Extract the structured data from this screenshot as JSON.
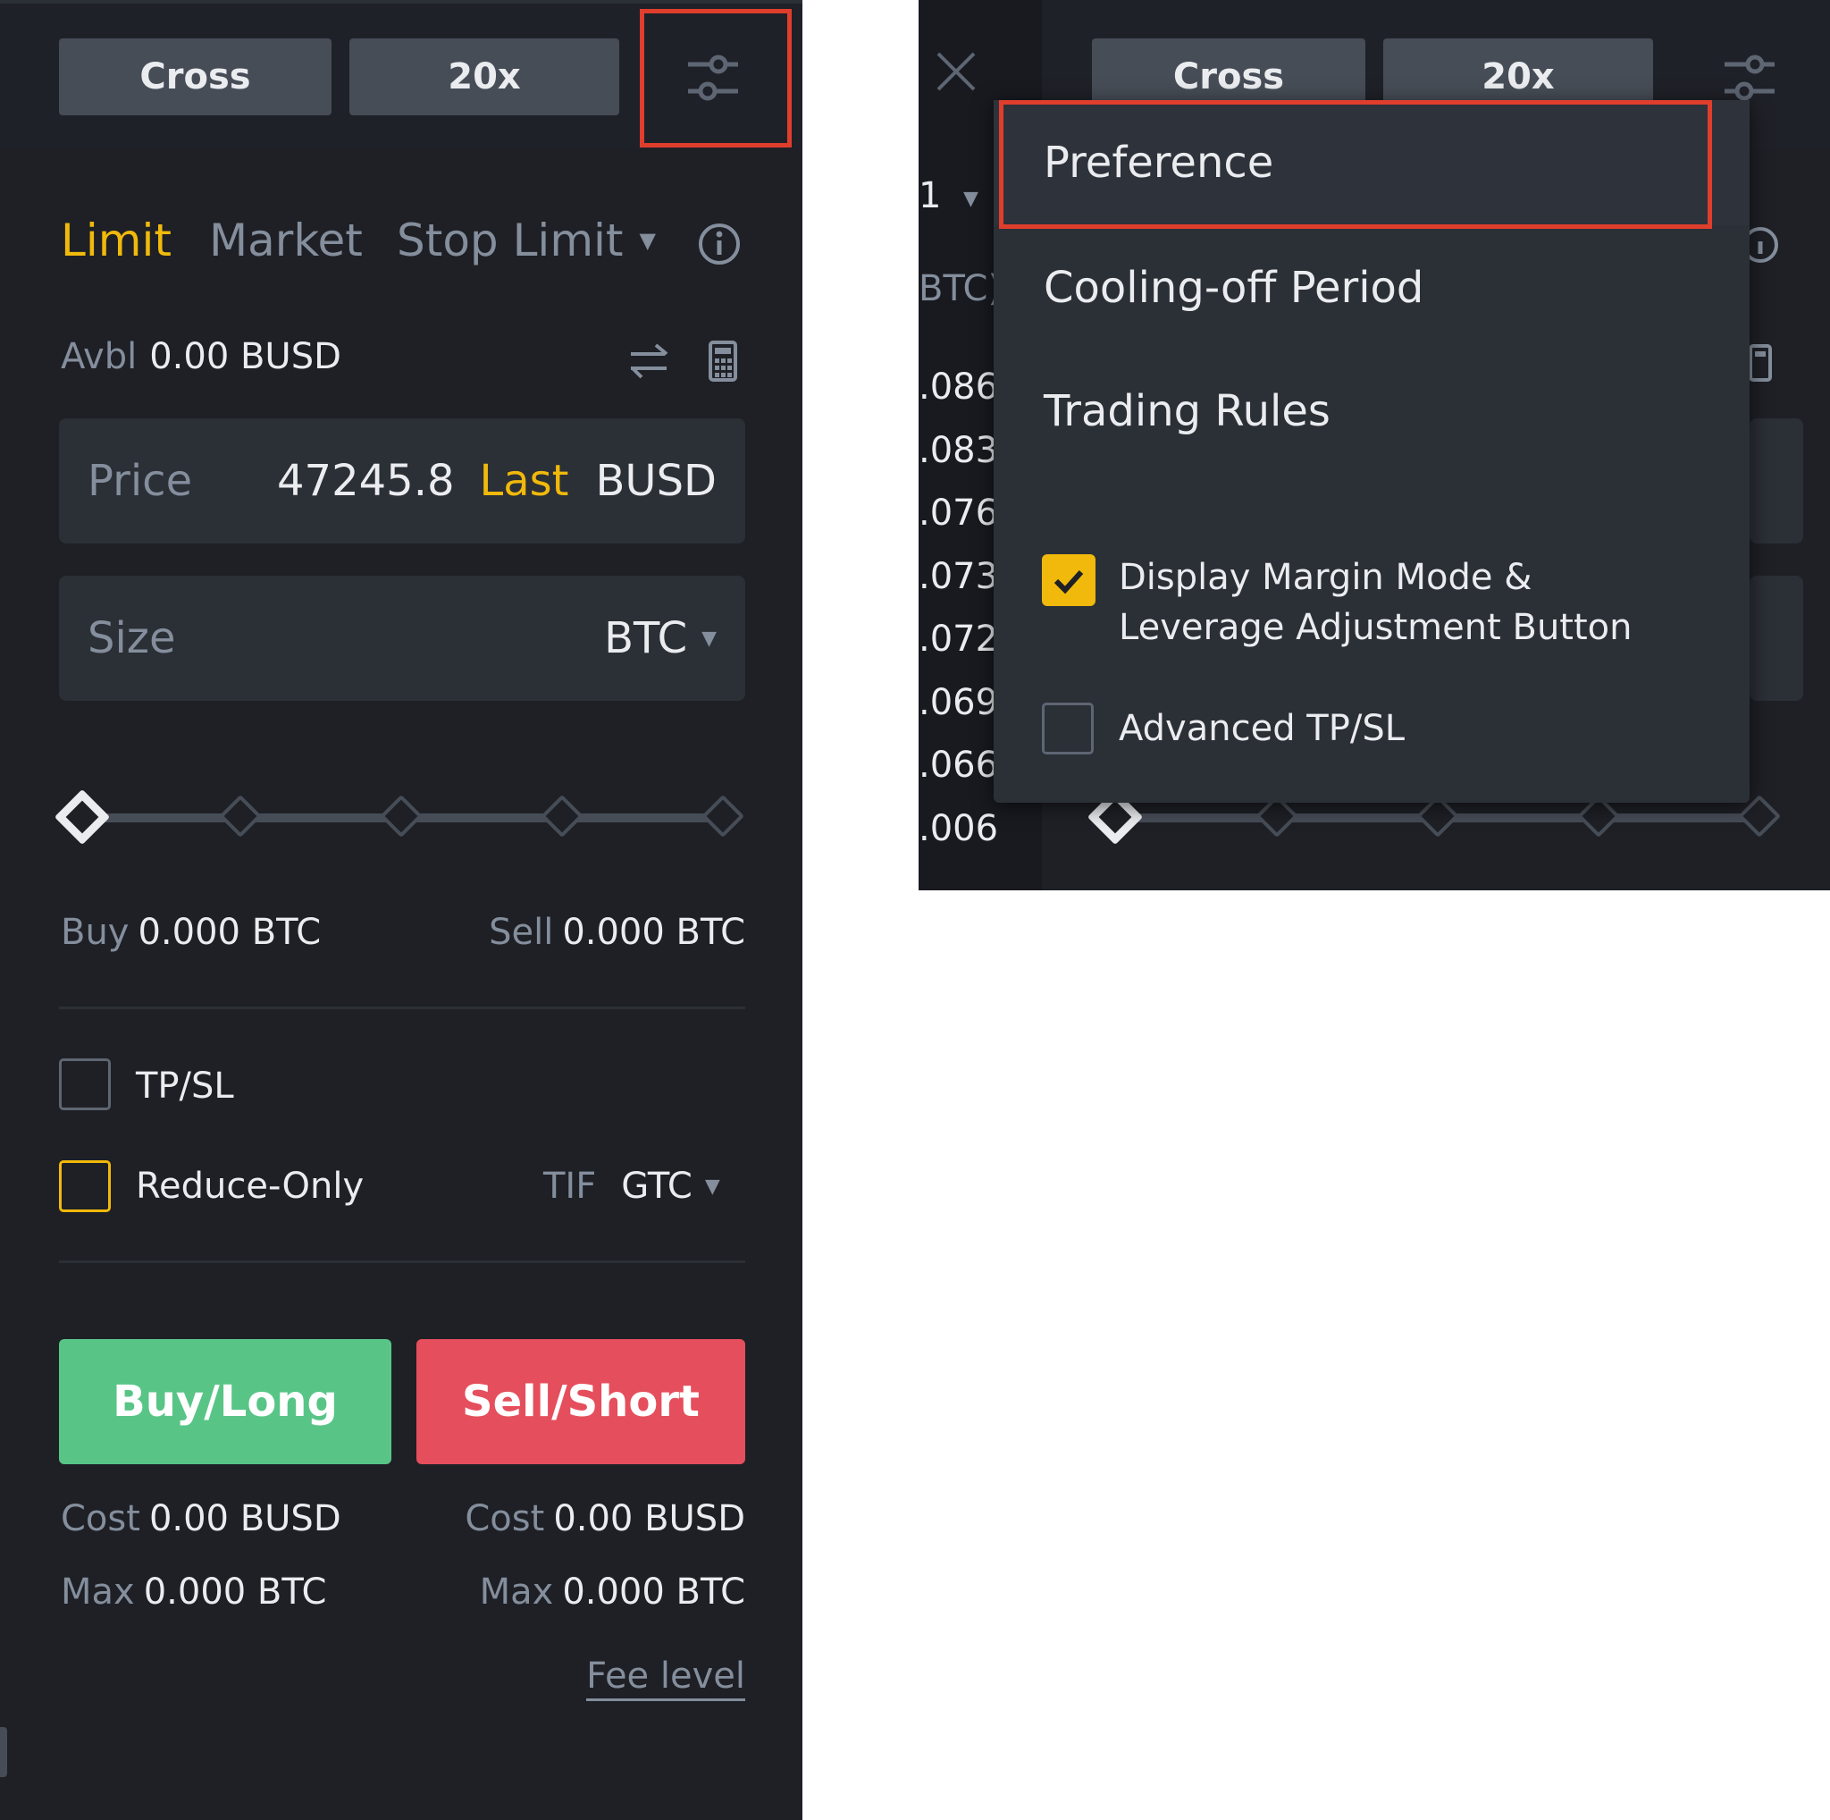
{
  "left": {
    "margin_mode": "Cross",
    "leverage": "20x",
    "tabs": [
      "Limit",
      "Market",
      "Stop Limit"
    ],
    "avbl_label": "Avbl",
    "avbl_value": "0.00 BUSD",
    "price_label": "Price",
    "price_value": "47245.8",
    "price_last": "Last",
    "price_unit": "BUSD",
    "size_label": "Size",
    "size_unit": "BTC",
    "slider_percent": 0,
    "buy_label": "Buy",
    "buy_value": "0.000 BTC",
    "sell_label": "Sell",
    "sell_value": "0.000 BTC",
    "tpsl_label": "TP/SL",
    "reduce_only_label": "Reduce-Only",
    "tif_label": "TIF",
    "tif_value": "GTC",
    "buy_button": "Buy/Long",
    "sell_button": "Sell/Short",
    "cost_label": "Cost",
    "cost_buy_value": "0.00 BUSD",
    "cost_sell_value": "0.00 BUSD",
    "max_label": "Max",
    "max_buy_value": "0.000 BTC",
    "max_sell_value": "0.000 BTC",
    "fee_level": "Fee level"
  },
  "right": {
    "margin_mode": "Cross",
    "leverage": "20x",
    "bg_fragment_header": "BTC)",
    "bg_fragment_one": "1",
    "bg_prices": [
      ".086",
      ".083",
      ".076",
      ".073",
      ".072",
      ".069",
      ".066",
      ".006"
    ],
    "menu_items": [
      "Preference",
      "Cooling-off Period",
      "Trading Rules"
    ],
    "option_display_margin": "Display Margin Mode & Leverage Adjustment Button",
    "option_display_margin_checked": true,
    "option_advanced_tpsl": "Advanced TP/SL",
    "option_advanced_tpsl_checked": false
  },
  "colors": {
    "bg": "#1e2026",
    "field": "#2b2f36",
    "gold": "#f0b90b",
    "buy": "#58c587",
    "sell": "#e54e5c",
    "highlight": "#e03e2d"
  }
}
